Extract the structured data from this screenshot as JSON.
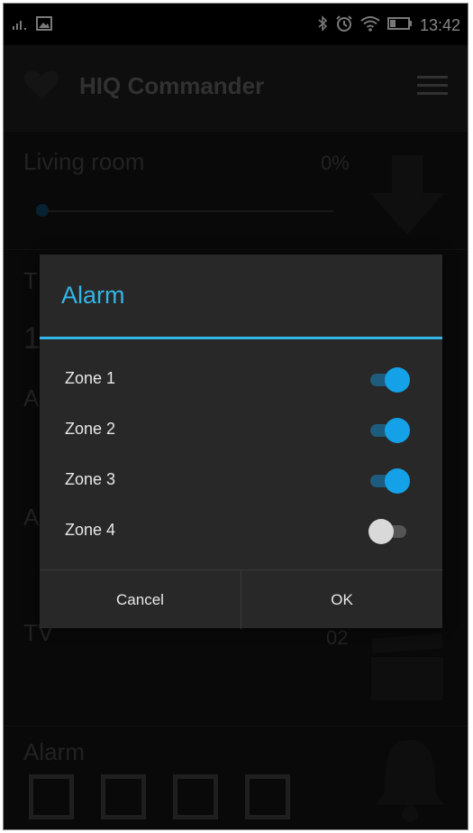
{
  "status_bar": {
    "time": "13:42",
    "icons": [
      "signal-icon",
      "image-icon",
      "bluetooth-icon",
      "alarm-clock-icon",
      "wifi-icon",
      "battery-icon"
    ]
  },
  "app_bar": {
    "title": "HIQ Commander",
    "icons": [
      "heart-icon",
      "menu-icon"
    ]
  },
  "background": {
    "living_room": {
      "label": "Living room",
      "value": "0%",
      "slider_level": 0
    },
    "partial_labels": [
      "T",
      "1",
      "A",
      "A"
    ],
    "tv": {
      "label": "TV",
      "value": "02"
    },
    "alarm": {
      "label": "Alarm",
      "checkbox_count": 4
    }
  },
  "dialog": {
    "title": "Alarm",
    "zones": [
      {
        "label": "Zone 1",
        "enabled": true
      },
      {
        "label": "Zone 2",
        "enabled": true
      },
      {
        "label": "Zone 3",
        "enabled": true
      },
      {
        "label": "Zone 4",
        "enabled": false
      }
    ],
    "cancel_label": "Cancel",
    "ok_label": "OK"
  },
  "colors": {
    "accent": "#33b5e5",
    "toggle_on": "#14a1e7",
    "toggle_off": "#d9d9d9",
    "dialog_bg": "#282828"
  }
}
